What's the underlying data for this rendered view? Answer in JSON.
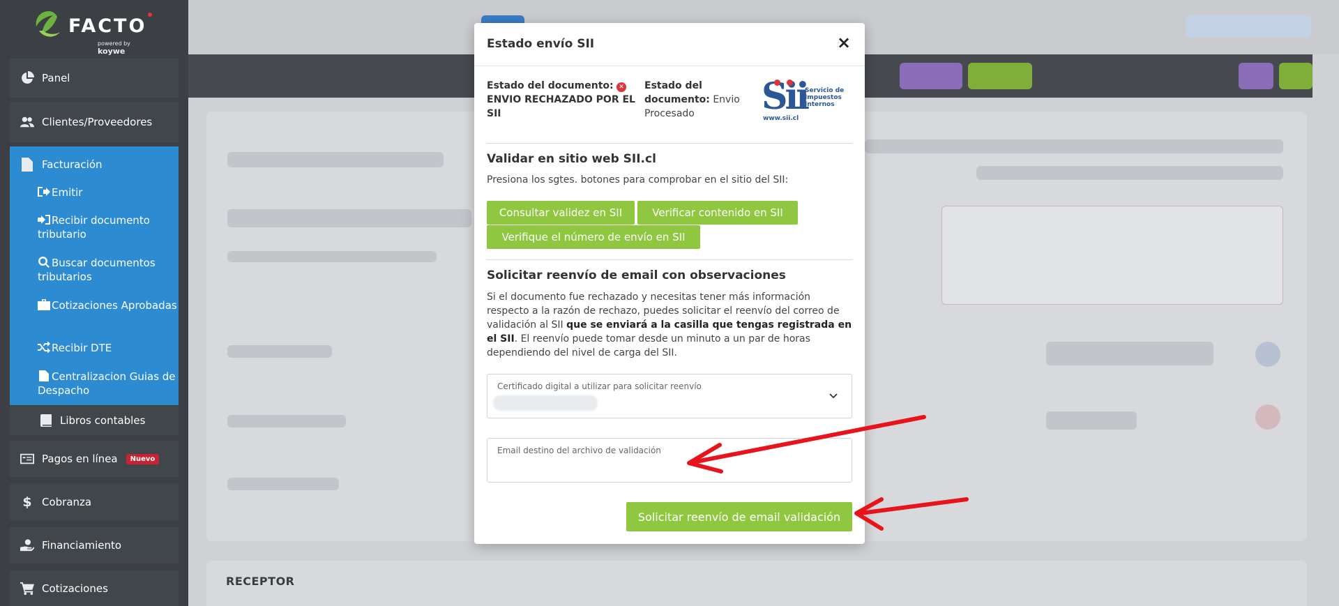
{
  "sidebar": {
    "brand": "FACTO",
    "powered_by": "powered by",
    "powered_brand": "koywe",
    "items": {
      "panel": "Panel",
      "clientes": "Clientes/Proveedores",
      "facturacion": "Facturación",
      "emitir": "Emitir",
      "recibir_doc": "Recibir documento tributario",
      "buscar_doc": "Buscar documentos tributarios",
      "cotizaciones_aprobadas": "Cotizaciones Aprobadas",
      "recibir_dte": "Recibir DTE",
      "centralizacion": "Centralizacion Guias de Despacho",
      "libros": "Libros contables",
      "pagos": "Pagos en línea",
      "pagos_badge": "Nuevo",
      "cobranza": "Cobranza",
      "financiamiento": "Financiamiento",
      "cotizaciones": "Cotizaciones"
    }
  },
  "background": {
    "receptor_title": "RECEPTOR"
  },
  "modal": {
    "title": "Estado envío SII",
    "close_symbol": "×",
    "status_left_label": "Estado del documento:",
    "status_left_value": "ENVIO RECHAZADO POR EL SII",
    "status_mid_label": "Estado del documento:",
    "status_mid_value": "Envio Procesado",
    "sii_logo": {
      "mark": "Sii",
      "url": "www.sii.cl",
      "service": "Servicio de Impuestos Internos"
    },
    "validar": {
      "title": "Validar en sitio web SII.cl",
      "text": "Presiona los sgtes. botones para comprobar en el sitio del SII:",
      "btn_consultar": "Consultar validez en SII",
      "btn_verificar": "Verificar contenido en SII",
      "btn_numero": "Verifique el número de envío en SII"
    },
    "reenvio": {
      "title": "Solicitar reenvío de email con observaciones",
      "text_1": "Si el documento fue rechazado y necesitas tener más información respecto a la razón de rechazo, puedes solicitar el reenvío del correo de validación al SII ",
      "text_bold": "que se enviará a la casilla que tengas registrada en el SII",
      "text_2": ". El reenvío puede tomar desde un minuto a un par de horas dependiendo del nivel de carga del SII.",
      "cert_label": "Certificado digital a utilizar para solicitar reenvío",
      "email_label": "Email destino del archivo de validación",
      "btn_submit": "Solicitar reenvío de email validación"
    }
  },
  "colors": {
    "sidebar_bg": "#3c4044",
    "active_group": "#2c8bd1",
    "button_green": "#8fc740",
    "danger": "#d9363e",
    "annotation_arrow": "#e8141b"
  }
}
